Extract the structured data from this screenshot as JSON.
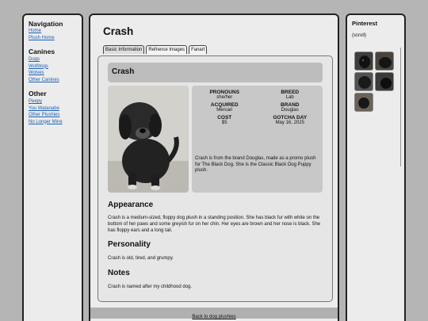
{
  "nav": {
    "title": "Navigation",
    "links": [
      "Home",
      "Plush Home"
    ],
    "canines_heading": "Canines",
    "canines": [
      "Dogs",
      "Wolfdogs",
      "Wolves",
      "Other Canines"
    ],
    "other_heading": "Other",
    "other": [
      "Peepy",
      "You Watanabe",
      "Other Plushies",
      "No Longer Mine"
    ]
  },
  "main": {
    "title": "Crash",
    "tabs": [
      "Basic Information",
      "Refrence Images",
      "Fanart"
    ],
    "active_tab": 0
  },
  "profile": {
    "name": "Crash",
    "fields": [
      {
        "label": "PRONOUNS",
        "value": "she/her"
      },
      {
        "label": "BREED",
        "value": "Lab"
      },
      {
        "label": "ACQUIRED",
        "value": "Mercari"
      },
      {
        "label": "BRAND",
        "value": "Douglas"
      },
      {
        "label": "COST",
        "value": "$5"
      },
      {
        "label": "GOTCHA DAY",
        "value": "May 16, 2025"
      }
    ],
    "blurb": "Crash is from the brand Douglas, made as a promo plush for The Black Dog. She is the Classic Black Dog Puppy plush."
  },
  "sections": {
    "appearance_h": "Appearance",
    "appearance": "Crash is a medium-sized, floppy dog plush in a standing position. She has black fur with white on the bottom of her paws and some greyish fur on her chin. Her eyes are brown and her nose is black. She has floppy ears and a long tail.",
    "personality_h": "Personality",
    "personality": "Crash is old, tired, and grumpy.",
    "notes_h": "Notes",
    "notes": "Crash is named after my childhood dog."
  },
  "footer": {
    "back": "Back to dog plushies"
  },
  "pinterest": {
    "title": "Pinterest",
    "subtitle": "(scroll)"
  },
  "colors": {
    "page_bg": "#b5b5b5",
    "panel_bg": "#ececec",
    "link": "#1a5fb4",
    "name_bar": "#bdbdbd"
  }
}
